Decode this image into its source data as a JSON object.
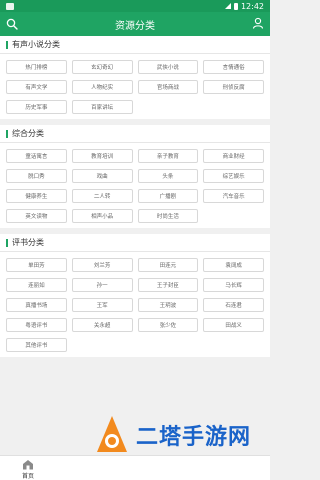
{
  "status_bar": {
    "time": "12:42"
  },
  "app_bar": {
    "title": "资源分类"
  },
  "sections": [
    {
      "title": "有声小说分类",
      "tags": [
        "热门排榜",
        "玄幻奇幻",
        "武侠小说",
        "言情通俗",
        "有声文学",
        "人物纪实",
        "官场商战",
        "刑侦反腐",
        "历史军事",
        "百家讲坛"
      ]
    },
    {
      "title": "综合分类",
      "tags": [
        "童话寓言",
        "教育培训",
        "亲子教育",
        "商业财经",
        "脱口秀",
        "戏曲",
        "头条",
        "综艺娱乐",
        "健康养生",
        "二人转",
        "广播剧",
        "汽车音乐",
        "英文读物",
        "相声小品",
        "时尚生活"
      ]
    },
    {
      "title": "评书分类",
      "tags": [
        "单田芳",
        "刘兰芳",
        "田连元",
        "袁阔成",
        "连丽如",
        "孙一",
        "王子封臣",
        "马长辉",
        "真播书场",
        "王军",
        "王玥波",
        "石连君",
        "粤语评书",
        "关永超",
        "张少佐",
        "田战义",
        "其他评书"
      ]
    }
  ],
  "bottom_nav": {
    "home_label": "首页"
  },
  "watermark": {
    "text": "二塔手游网"
  },
  "colors": {
    "primary": "#1fa463",
    "status_bar": "#1a9a5a",
    "watermark_blue": "#1a63c9",
    "watermark_orange": "#f28a1e"
  }
}
